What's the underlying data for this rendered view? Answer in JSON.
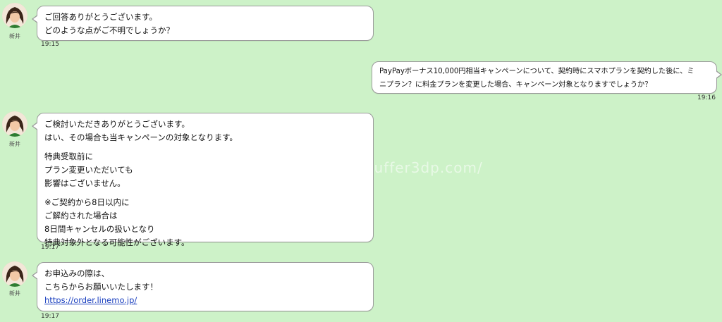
{
  "agent": {
    "name": "新井"
  },
  "watermark": "https://www.zbuffer3dp.com/",
  "messages": [
    {
      "lines": [
        "ご回答ありがとうございます。",
        "どのような点がご不明でしょうか？"
      ],
      "time": "19:15"
    },
    {
      "lines": [
        "PayPayボーナス10,000円相当キャンペーンについて、契約時にスマホプランを契約した後に、ミ",
        "ニプラン？に料金プランを変更した場合、キャンペーン対象となりますでしょうか？"
      ],
      "time": "19:16"
    },
    {
      "lines": [
        "ご検討いただきありがとうございます。",
        "はい、その場合も当キャンペーンの対象となります。",
        "特典受取前に",
        "プラン変更いただいても",
        "影響はございません。",
        "※ご契約から8日以内に",
        "ご解約された場合は",
        "8日間キャンセルの扱いとなり",
        "特典対象外となる可能性がございます。"
      ],
      "time": "19:17"
    },
    {
      "lines": [
        "お申込みの際は、",
        "こちらからお願いいたします！"
      ],
      "link": "https://order.linemo.jp/",
      "time": "19:17"
    }
  ]
}
